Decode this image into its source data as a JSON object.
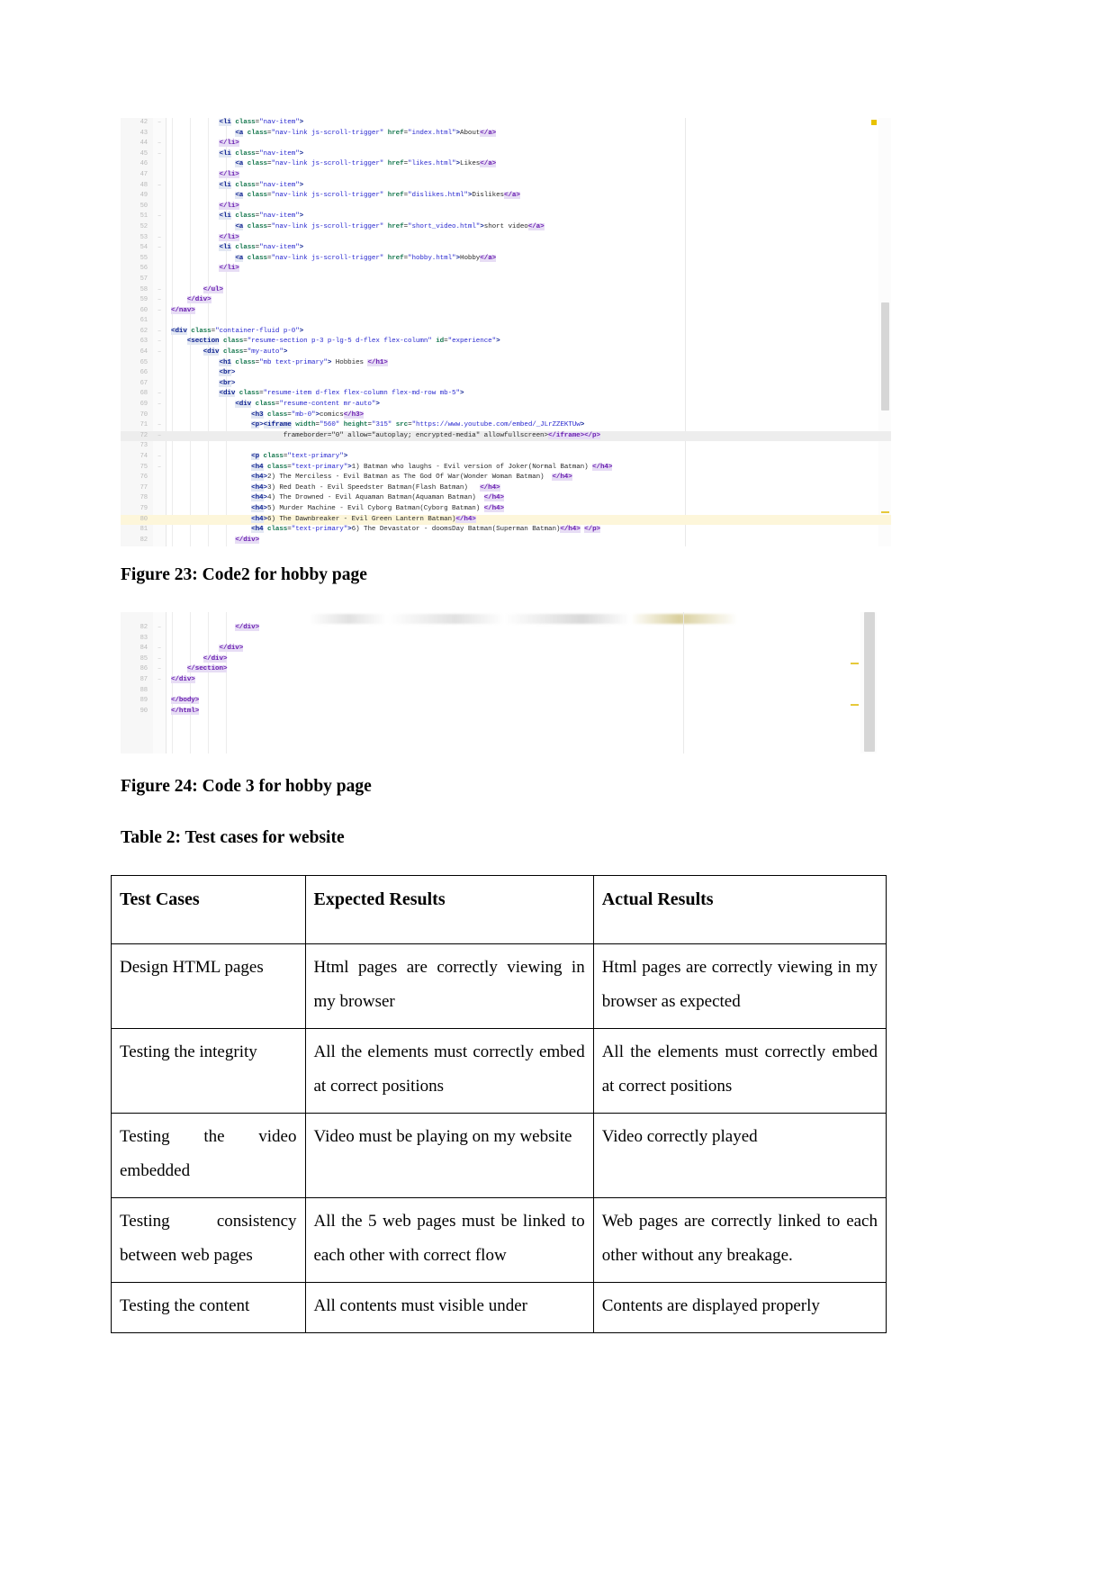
{
  "document": {
    "page_background": "#ffffff",
    "captions": {
      "figure23": "Figure 23: Code2 for hobby page",
      "figure24": "Figure 24: Code 3 for hobby page",
      "table2": "Table 2: Test cases for website"
    }
  },
  "code_block_1": {
    "name": "hobby-page-code-2",
    "lines": [
      {
        "num": "42",
        "fold": "−",
        "indent": 3,
        "text": "<li class=\"nav-item\">"
      },
      {
        "num": "43",
        "fold": "",
        "indent": 4,
        "text": "<a class=\"nav-link js-scroll-trigger\" href=\"index.html\">About</a>"
      },
      {
        "num": "44",
        "fold": "−",
        "indent": 3,
        "text": "</li>"
      },
      {
        "num": "45",
        "fold": "−",
        "indent": 3,
        "text": "<li class=\"nav-item\">"
      },
      {
        "num": "46",
        "fold": "",
        "indent": 4,
        "text": "<a class=\"nav-link js-scroll-trigger\" href=\"likes.html\">Likes</a>"
      },
      {
        "num": "47",
        "fold": "",
        "indent": 3,
        "text": "</li>"
      },
      {
        "num": "48",
        "fold": "−",
        "indent": 3,
        "text": "<li class=\"nav-item\">"
      },
      {
        "num": "49",
        "fold": "",
        "indent": 4,
        "text": "<a class=\"nav-link js-scroll-trigger\" href=\"dislikes.html\">Dislikes</a>"
      },
      {
        "num": "50",
        "fold": "",
        "indent": 3,
        "text": "</li>"
      },
      {
        "num": "51",
        "fold": "−",
        "indent": 3,
        "text": "<li class=\"nav-item\">"
      },
      {
        "num": "52",
        "fold": "",
        "indent": 4,
        "text": "<a class=\"nav-link js-scroll-trigger\" href=\"short_video.html\">short video</a>"
      },
      {
        "num": "53",
        "fold": "−",
        "indent": 3,
        "text": "</li>"
      },
      {
        "num": "54",
        "fold": "−",
        "indent": 3,
        "text": "<li class=\"nav-item\">"
      },
      {
        "num": "55",
        "fold": "",
        "indent": 4,
        "text": "<a class=\"nav-link js-scroll-trigger\" href=\"hobby.html\">Hobby</a>"
      },
      {
        "num": "56",
        "fold": "",
        "indent": 3,
        "text": "</li>"
      },
      {
        "num": "57",
        "fold": "",
        "indent": 0,
        "text": ""
      },
      {
        "num": "58",
        "fold": "−",
        "indent": 2,
        "text": "</ul>"
      },
      {
        "num": "59",
        "fold": "−",
        "indent": 1,
        "text": "</div>"
      },
      {
        "num": "60",
        "fold": "−",
        "indent": 0,
        "text": "</nav>"
      },
      {
        "num": "61",
        "fold": "",
        "indent": 0,
        "text": ""
      },
      {
        "num": "62",
        "fold": "−",
        "indent": 0,
        "text": "<div class=\"container-fluid p-0\">"
      },
      {
        "num": "63",
        "fold": "−",
        "indent": 1,
        "text": "<section class=\"resume-section p-3 p-lg-5 d-flex flex-column\" id=\"experience\">"
      },
      {
        "num": "64",
        "fold": "−",
        "indent": 2,
        "text": "<div class=\"my-auto\">"
      },
      {
        "num": "65",
        "fold": "",
        "indent": 3,
        "text": "<h1 class=\"mb text-primary\"> Hobbies </h1>"
      },
      {
        "num": "66",
        "fold": "",
        "indent": 3,
        "text": "<br>"
      },
      {
        "num": "67",
        "fold": "",
        "indent": 3,
        "text": "<br>"
      },
      {
        "num": "68",
        "fold": "−",
        "indent": 3,
        "text": "<div class=\"resume-item d-flex flex-column flex-md-row mb-5\">"
      },
      {
        "num": "69",
        "fold": "−",
        "indent": 4,
        "text": "<div class=\"resume-content mr-auto\">"
      },
      {
        "num": "70",
        "fold": "",
        "indent": 5,
        "text": "<h3 class=\"mb-0\">comics</h3>"
      },
      {
        "num": "71",
        "fold": "−",
        "indent": 5,
        "text": "<p><iframe width=\"560\" height=\"315\" src=\"https://www.youtube.com/embed/_JLrZZEKTUw\""
      },
      {
        "num": "72",
        "fold": "−",
        "indent": 7,
        "text": "frameborder=\"0\" allow=\"autoplay; encrypted-media\" allowfullscreen></iframe></p>"
      },
      {
        "num": "73",
        "fold": "",
        "indent": 0,
        "text": ""
      },
      {
        "num": "74",
        "fold": "−",
        "indent": 5,
        "text": "<p class=\"text-primary\">"
      },
      {
        "num": "75",
        "fold": "−",
        "indent": 5,
        "text": "<h4 class=\"text-primary\">1) Batman who laughs - Evil version of Joker(Normal Batman) </h4>"
      },
      {
        "num": "76",
        "fold": "",
        "indent": 5,
        "text": "<h4>2) The Merciless - Evil Batman as The God Of War(Wonder Woman Batman)  </h4>"
      },
      {
        "num": "77",
        "fold": "",
        "indent": 5,
        "text": "<h4>3) Red Death - Evil Speedster Batman(Flash Batman)   </h4>"
      },
      {
        "num": "78",
        "fold": "",
        "indent": 5,
        "text": "<h4>4) The Drowned - Evil Aquaman Batman(Aquaman Batman)  </h4>"
      },
      {
        "num": "79",
        "fold": "",
        "indent": 5,
        "text": "<h4>5) Murder Machine - Evil Cyborg Batman(Cyborg Batman) </h4>"
      },
      {
        "num": "80",
        "fold": "",
        "indent": 5,
        "text": "<h4>6) The Dawnbreaker - Evil Green Lantern Batman)</h4>"
      },
      {
        "num": "81",
        "fold": "",
        "indent": 5,
        "text": "<h4 class=\"text-primary\">6) The Devastator - doomsDay Batman(Superman Batman)</h4> </p>"
      },
      {
        "num": "82",
        "fold": "",
        "indent": 4,
        "text": "</div>"
      }
    ]
  },
  "code_block_2": {
    "name": "hobby-page-code-3",
    "lines": [
      {
        "num": "82",
        "fold": "−",
        "indent": 4,
        "text": "</div>"
      },
      {
        "num": "83",
        "fold": "",
        "indent": 0,
        "text": ""
      },
      {
        "num": "84",
        "fold": "−",
        "indent": 3,
        "text": "</div>"
      },
      {
        "num": "85",
        "fold": "−",
        "indent": 2,
        "text": "</div>"
      },
      {
        "num": "86",
        "fold": "−",
        "indent": 1,
        "text": "</section>"
      },
      {
        "num": "87",
        "fold": "−",
        "indent": 0,
        "text": "</div>"
      },
      {
        "num": "88",
        "fold": "",
        "indent": 0,
        "text": ""
      },
      {
        "num": "89",
        "fold": "",
        "indent": 0,
        "text": "</body>"
      },
      {
        "num": "90",
        "fold": "",
        "indent": 0,
        "text": "</html>"
      }
    ]
  },
  "table2": {
    "headers": [
      "Test Cases",
      "Expected Results",
      "Actual Results"
    ],
    "rows": [
      {
        "test_case": "Design HTML pages",
        "expected": "Html pages are correctly viewing in my browser",
        "actual": "Html pages are correctly viewing in my browser as expected"
      },
      {
        "test_case": "Testing the integrity",
        "expected": "All the elements must correctly embed at correct positions",
        "actual": "All the elements must correctly embed at correct positions"
      },
      {
        "test_case": "Testing the video embedded",
        "expected": "Video must be playing on my website",
        "actual": "Video correctly played"
      },
      {
        "test_case": "Testing consistency between web pages",
        "expected": "All the 5 web pages must be linked to each other with correct flow",
        "actual": "Web pages are correctly linked to each other without any breakage."
      },
      {
        "test_case": "Testing the content",
        "expected": "All contents must visible under",
        "actual": "Contents are displayed properly"
      }
    ]
  }
}
